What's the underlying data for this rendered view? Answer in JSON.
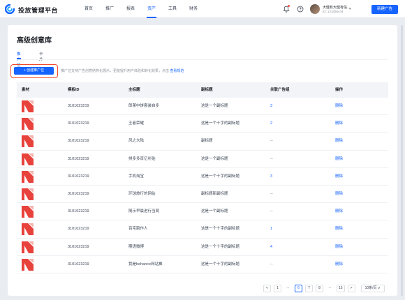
{
  "app": {
    "title": "投放管理平台"
  },
  "nav": [
    "首页",
    "推广",
    "报表",
    "资产",
    "工具",
    "财务"
  ],
  "nav_active": "资产",
  "user": {
    "name": "大健有大健有信...",
    "id": "ID: 123456444"
  },
  "header": {
    "new_ad_label": "新建广告"
  },
  "page": {
    "title": "高级创意库"
  },
  "tabs": [
    {
      "label": "推广位",
      "active": true
    },
    {
      "label": "卡片",
      "active": false
    }
  ],
  "toolbar": {
    "create_label": "+ 创建推广位",
    "tip": "推广位支持广告创意结构化展示，更能提升用户体验和转化效果，点击",
    "tip_link": "查看规范"
  },
  "table": {
    "columns": [
      "素材",
      "模板ID",
      "主标题",
      "副标题",
      "关联广告组",
      "操作"
    ],
    "rows": [
      {
        "template_id": "3101023219",
        "title": "郎莱中饼套装自多",
        "subtitle": "这是一个副标题",
        "ad_groups": "3",
        "action": "删除"
      },
      {
        "template_id": "3101023219",
        "title": "王者荣耀",
        "subtitle": "这是一个十字的副标题",
        "ad_groups": "2",
        "action": "删除"
      },
      {
        "template_id": "3101023219",
        "title": "风之大陆",
        "subtitle": "副标题",
        "ad_groups": "--",
        "action": "删除"
      },
      {
        "template_id": "3101023219",
        "title": "拼多多百亿补贴",
        "subtitle": "这是一个副标题",
        "ad_groups": "--",
        "action": "删除"
      },
      {
        "template_id": "3101023219",
        "title": "手机淘宝",
        "subtitle": "这是一个十字的副标题",
        "ad_groups": "3",
        "action": "删除"
      },
      {
        "template_id": "3101023219",
        "title": "环球旅行的网站",
        "subtitle": "副标题新副标题",
        "ad_groups": "--",
        "action": "删除"
      },
      {
        "template_id": "3101023219",
        "title": "随示早晨进行当局",
        "subtitle": "这是一个副标题",
        "ad_groups": "--",
        "action": "删除"
      },
      {
        "template_id": "3101023219",
        "title": "百宅跑作人",
        "subtitle": "这是一个十字的副标题",
        "ad_groups": "1",
        "action": "删除"
      },
      {
        "template_id": "3101023219",
        "title": "期语微博",
        "subtitle": "这是一个十字的副标题",
        "ad_groups": "4",
        "action": "删除"
      },
      {
        "template_id": "3101023219",
        "title": "我是behance网站推",
        "subtitle": "这是一个十字的副标题",
        "ad_groups": "--",
        "action": "删除"
      }
    ]
  },
  "pagination": {
    "prev": "<",
    "pages": [
      "1",
      "...",
      "6",
      "7",
      "8",
      "...",
      "15"
    ],
    "current": "6",
    "next": ">",
    "page_size": "10条/页 ∨"
  },
  "colors": {
    "primary": "#1664ff",
    "highlight_border": "#f04a2e",
    "thumb_red": "#e8423c"
  }
}
